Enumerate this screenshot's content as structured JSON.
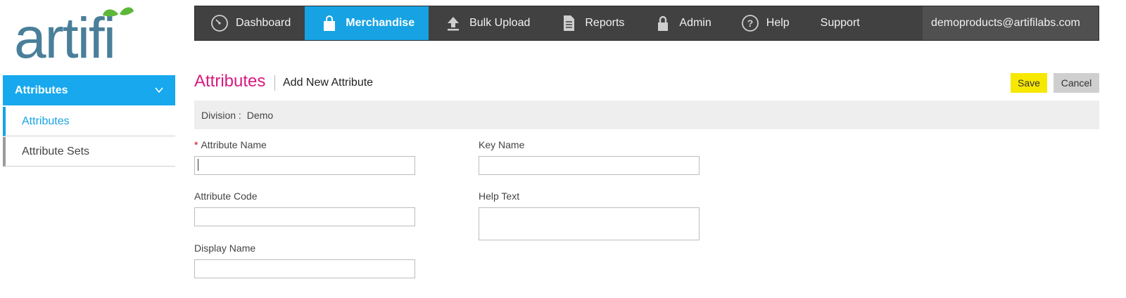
{
  "logo": {
    "text": "artifi",
    "brand_color": "#4a7f99",
    "leaf_color": "#5db83a"
  },
  "nav": {
    "items": [
      {
        "label": "Dashboard",
        "icon": "speedometer-icon"
      },
      {
        "label": "Merchandise",
        "icon": "shopping-bag-icon",
        "active": true
      },
      {
        "label": "Bulk Upload",
        "icon": "upload-icon"
      },
      {
        "label": "Reports",
        "icon": "document-icon"
      },
      {
        "label": "Admin",
        "icon": "lock-icon"
      },
      {
        "label": "Help",
        "icon": "question-circle-icon"
      },
      {
        "label": "Support"
      }
    ],
    "user_email": "demoproducts@artifilabs.com",
    "bg_color": "#414141",
    "active_color": "#17a3e3"
  },
  "sidebar": {
    "header": "Attributes",
    "items": [
      {
        "label": "Attributes",
        "active": true
      },
      {
        "label": "Attribute Sets"
      }
    ]
  },
  "page": {
    "title": "Attributes",
    "subtitle": "Add New Attribute",
    "save_label": "Save",
    "cancel_label": "Cancel"
  },
  "division": {
    "label": "Division :",
    "value": "Demo"
  },
  "form": {
    "attribute_name": {
      "label": "Attribute Name",
      "required_mark": "*",
      "value": ""
    },
    "key_name": {
      "label": "Key Name",
      "value": ""
    },
    "attribute_code": {
      "label": "Attribute Code",
      "value": ""
    },
    "help_text": {
      "label": "Help Text",
      "value": ""
    },
    "display_name": {
      "label": "Display Name",
      "value": ""
    }
  },
  "colors": {
    "title_pink": "#d81b7f",
    "save_yellow": "#f7e800",
    "cancel_gray": "#cfcfcf"
  }
}
